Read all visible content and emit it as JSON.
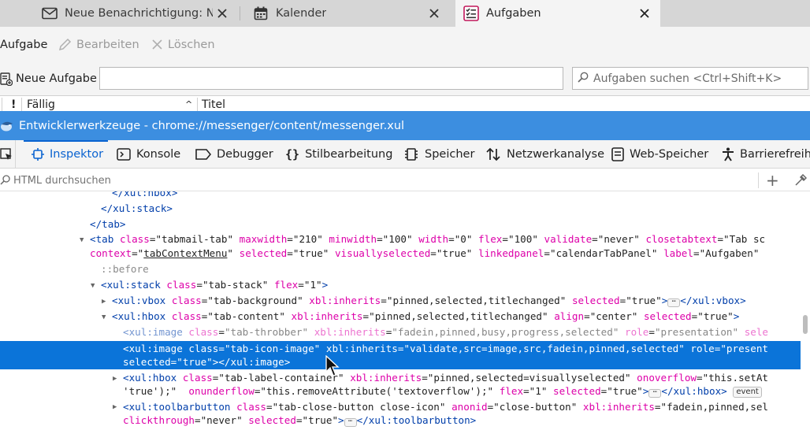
{
  "tabs": [
    {
      "label": "Neue Benachrichtigung: Neu",
      "icon": "envelope-icon",
      "active": false
    },
    {
      "label": "Kalender",
      "icon": "calendar-icon",
      "active": false
    },
    {
      "label": "Aufgaben",
      "icon": "tasks-icon",
      "active": true
    }
  ],
  "toolbar": {
    "new_task": "Aufgabe",
    "edit": "Bearbeiten",
    "delete": "Löschen"
  },
  "filter": {
    "new_task_label": "Neue Aufgabe",
    "new_task_value": "",
    "search_placeholder": "Aufgaben suchen <Ctrl+Shift+K>"
  },
  "columns": {
    "priority": "!",
    "due": "Fällig",
    "sort_indicator": "^",
    "title": "Titel"
  },
  "devtools": {
    "window_title": "Entwicklerwerkzeuge - chrome://messenger/content/messenger.xul",
    "tools": [
      {
        "label": "Inspektor",
        "icon": "inspector-icon",
        "selected": true
      },
      {
        "label": "Konsole",
        "icon": "console-icon",
        "selected": false
      },
      {
        "label": "Debugger",
        "icon": "debugger-icon",
        "selected": false
      },
      {
        "label": "Stilbearbeitung",
        "icon": "style-editor-icon",
        "selected": false
      },
      {
        "label": "Speicher",
        "icon": "memory-icon",
        "selected": false
      },
      {
        "label": "Netzwerkanalyse",
        "icon": "network-icon",
        "selected": false
      },
      {
        "label": "Web-Speicher",
        "icon": "storage-icon",
        "selected": false
      },
      {
        "label": "Barrierefreihe",
        "icon": "accessibility-icon",
        "selected": false
      }
    ],
    "html_search_placeholder": "HTML durchsuchen"
  },
  "markup": {
    "l0": "</xul:hbox>",
    "l1": "</xul:stack>",
    "l2": "</tab>",
    "l3_tag": "<tab",
    "l3_a1": "class",
    "l3_v1": "\"tabmail-tab\"",
    "l3_a2": "maxwidth",
    "l3_v2": "\"210\"",
    "l3_a3": "minwidth",
    "l3_v3": "\"100\"",
    "l3_a4": "width",
    "l3_v4": "\"0\"",
    "l3_a5": "flex",
    "l3_v5": "\"100\"",
    "l3_a6": "validate",
    "l3_v6": "\"never\"",
    "l3_a7": "closetabtext",
    "l3_v7": "\"Tab sc",
    "l4_a1": "context",
    "l4_v1q": "\"",
    "l4_v1": "tabContextMenu",
    "l4_v1e": "\"",
    "l4_a2": "selected",
    "l4_v2": "\"true\"",
    "l4_a3": "visuallyselected",
    "l4_v3": "\"true\"",
    "l4_a4": "linkedpanel",
    "l4_v4": "\"calendarTabPanel\"",
    "l4_a5": "label",
    "l4_v5": "\"Aufgaben\"",
    "l5": "::before",
    "l6_tag": "<xul:stack",
    "l6_a1": "class",
    "l6_v1": "\"tab-stack\"",
    "l6_a2": "flex",
    "l6_v2": "\"1\"",
    "l6_end": ">",
    "l7_tag": "<xul:vbox",
    "l7_a1": "class",
    "l7_v1": "\"tab-background\"",
    "l7_a2": "xbl:inherits",
    "l7_v2": "\"pinned,selected,titlechanged\"",
    "l7_a3": "selected",
    "l7_v3": "\"true\"",
    "l7_end": ">",
    "l7_close": "</xul:vbox>",
    "l8_tag": "<xul:hbox",
    "l8_a1": "class",
    "l8_v1": "\"tab-content\"",
    "l8_a2": "xbl:inherits",
    "l8_v2": "\"pinned,selected,titlechanged\"",
    "l8_a3": "align",
    "l8_v3": "\"center\"",
    "l8_a4": "selected",
    "l8_v4": "\"true\"",
    "l8_end": ">",
    "l9_tag": "<xul:image",
    "l9_a1": "class",
    "l9_v1": "\"tab-throbber\"",
    "l9_a2": "xbl:inherits",
    "l9_v2": "\"fadein,pinned,busy,progress,selected\"",
    "l9_a3": "role",
    "l9_v3": "\"presentation\"",
    "l9_a4": "sele",
    "l10_tag": "<xul:image",
    "l10_a1": "class",
    "l10_v1": "\"tab-icon-image\"",
    "l10_a2": "xbl:inherits",
    "l10_v2": "\"validate,src=image,src,fadein,pinned,selected\"",
    "l10_a3": "role",
    "l10_v3": "\"present",
    "l11_a1": "selected",
    "l11_v1": "\"true\"",
    "l11_end": "></xul:image>",
    "l12_tag": "<xul:hbox",
    "l12_a1": "class",
    "l12_v1": "\"tab-label-container\"",
    "l12_a2": "xbl:inherits",
    "l12_v2": "\"pinned,selected=visuallyselected\"",
    "l12_a3": "onoverflow",
    "l12_v3": "\"this.setAt",
    "l13_v0": "'true');\"",
    "l13_a1": "onunderflow",
    "l13_v1": "\"this.removeAttribute('textoverflow');\"",
    "l13_a2": "flex",
    "l13_v2": "\"1\"",
    "l13_a3": "selected",
    "l13_v3": "\"true\"",
    "l13_end": ">",
    "l13_close": "</xul:hbox>",
    "l13_badge": "event",
    "l14_tag": "<xul:toolbarbutton",
    "l14_a1": "class",
    "l14_v1": "\"tab-close-button close-icon\"",
    "l14_a2": "anonid",
    "l14_v2": "\"close-button\"",
    "l14_a3": "xbl:inherits",
    "l14_v3": "\"fadein,pinned,sel",
    "l15_a1": "clickthrough",
    "l15_v1": "\"never\"",
    "l15_a2": "selected",
    "l15_v2": "\"true\"",
    "l15_end": ">",
    "l15_close": "</xul:toolbarbutton>",
    "eq": "=",
    "ellipsis": "⋯"
  }
}
